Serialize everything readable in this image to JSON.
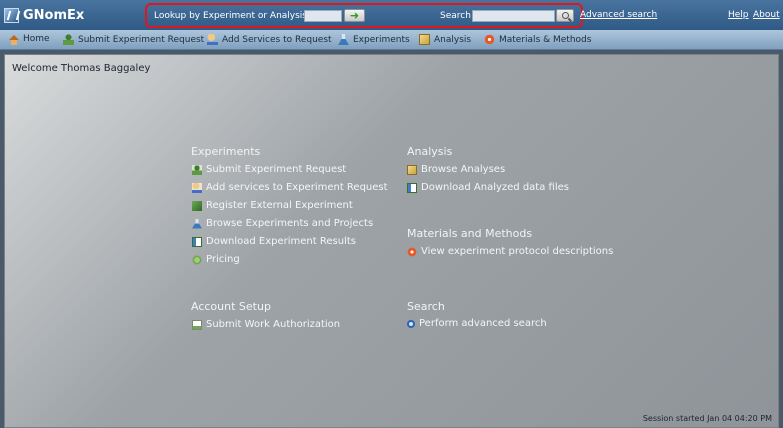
{
  "app": {
    "title": "GNomEx"
  },
  "header": {
    "lookup_label": "Lookup by Experiment or Analysis #",
    "lookup_value": "",
    "search_label": "Search",
    "search_value": "",
    "advanced_search_label": "Advanced search",
    "help_label": "Help",
    "about_label": "About",
    "highlight_color": "#e0161c"
  },
  "nav": {
    "items": [
      {
        "label": "Home",
        "icon": "home-icon"
      },
      {
        "label": "Submit Experiment Request",
        "icon": "person-icon"
      },
      {
        "label": "Add Services to Request",
        "icon": "hand-icon"
      },
      {
        "label": "Experiments",
        "icon": "flask-icon"
      },
      {
        "label": "Analysis",
        "icon": "chart-icon"
      },
      {
        "label": "Materials & Methods",
        "icon": "gear-icon"
      }
    ]
  },
  "main": {
    "welcome": "Welcome Thomas Baggaley",
    "experiments": {
      "heading": "Experiments",
      "links": [
        "Submit Experiment Request",
        "Add services to Experiment Request",
        "Register External Experiment",
        "Browse Experiments and Projects",
        "Download Experiment Results",
        "Pricing"
      ]
    },
    "analysis": {
      "heading": "Analysis",
      "links": [
        "Browse Analyses",
        "Download Analyzed data files"
      ]
    },
    "materials": {
      "heading": "Materials and Methods",
      "links": [
        "View experiment protocol descriptions"
      ]
    },
    "account": {
      "heading": "Account Setup",
      "links": [
        "Submit Work Authorization"
      ]
    },
    "search": {
      "heading": "Search",
      "links": [
        "Perform advanced search"
      ]
    },
    "session": "Session started Jan 04 04:20 PM"
  }
}
